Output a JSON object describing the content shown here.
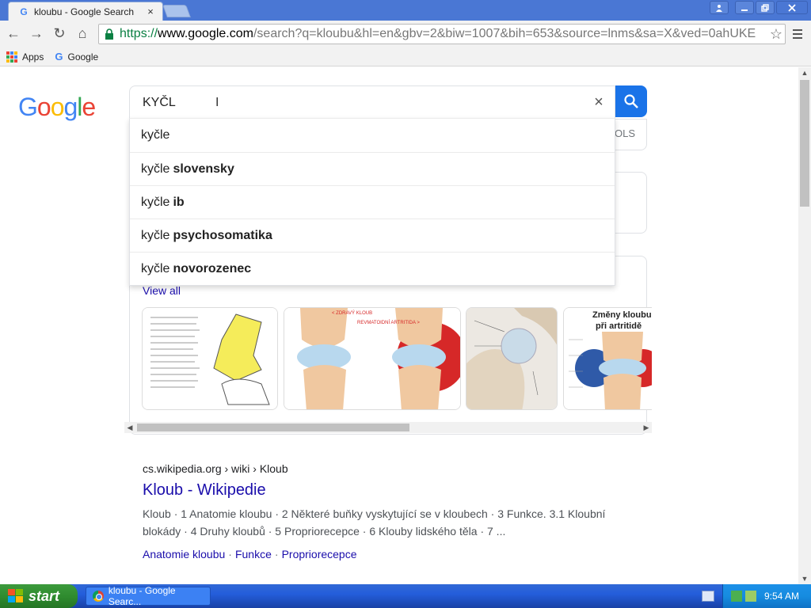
{
  "browser": {
    "tab_title": "kloubu - Google Search",
    "tab_close": "×",
    "url_scheme": "https://",
    "url_host": "www.google.com",
    "url_rest": "/search?q=kloubu&hl=en&gbv=2&biw=1007&bih=653&source=lnms&sa=X&ved=0ahUKE",
    "nav_back": "←",
    "nav_forward": "→",
    "nav_reload": "↻",
    "nav_home": "⌂",
    "star": "☆"
  },
  "bookmarks": {
    "apps": "Apps",
    "google": "Google"
  },
  "search": {
    "query": "KYČL",
    "clear": "×",
    "tools_partial": "OLS",
    "suggestions": [
      {
        "base": "kyčle",
        "ext": ""
      },
      {
        "base": "kyčle",
        "ext": "slovensky"
      },
      {
        "base": "kyčle",
        "ext": "ib"
      },
      {
        "base": "kyčle",
        "ext": "psychosomatika"
      },
      {
        "base": "kyčle",
        "ext": "novorozenec"
      }
    ]
  },
  "images": {
    "view_all": "View all",
    "thumb2_label": "< ZDRAVÝ KLOUB",
    "thumb2_label_b": "REVMATOIDNÍ ARTRITIDA >",
    "thumb4_title_1": "Změny kloubu",
    "thumb4_title_2": "při artritidě"
  },
  "result": {
    "breadcrumb": "cs.wikipedia.org › wiki › Kloub",
    "title": "Kloub - Wikipedie",
    "snippet_1": "Kloub · 1 Anatomie kloubu · 2 Některé buňky vyskytující se v kloubech · 3 Funkce. 3.1 Kloubní",
    "snippet_2": "blokády · 4 Druhy kloubů · 5 Propriorecepce · 6 Klouby lidského těla · 7 ...",
    "sitelinks": [
      "Anatomie kloubu",
      "Funkce",
      "Propriorecepce"
    ]
  },
  "taskbar": {
    "start": "start",
    "task_label": "kloubu - Google Searc...",
    "clock": "9:54 AM"
  },
  "colors": {
    "link": "#1a0dab",
    "search_button": "#1a73e8",
    "title_bar": "#4a77d4",
    "taskbar": "#245edb",
    "start_green": "#2f8c2f"
  }
}
